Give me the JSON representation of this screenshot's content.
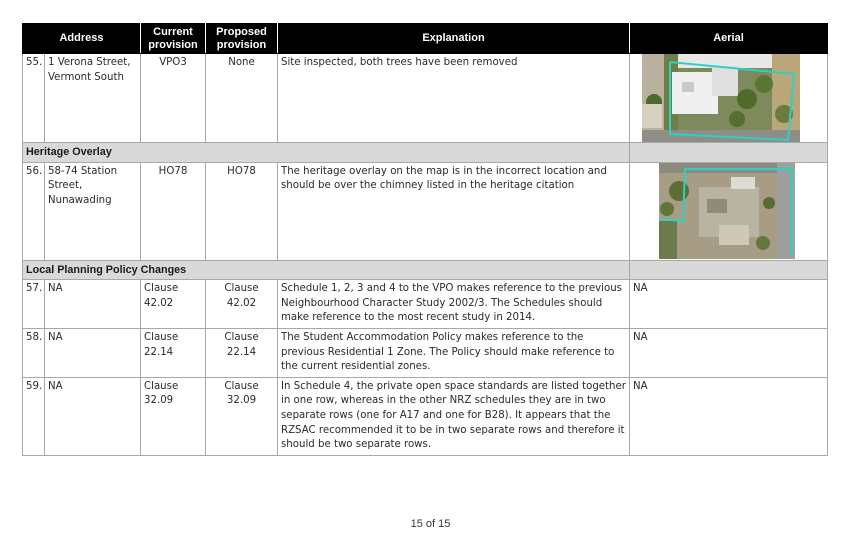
{
  "table": {
    "headers": {
      "address": "Address",
      "current": "Current provision",
      "proposed": "Proposed provision",
      "explanation": "Explanation",
      "aerial": "Aerial"
    },
    "row55": {
      "num": "55.",
      "address": "1 Verona Street, Vermont South",
      "current": "VPO3",
      "proposed": "None",
      "explanation": "Site inspected, both trees have been removed"
    },
    "section_heritage": "Heritage Overlay",
    "row56": {
      "num": "56.",
      "address": "58-74 Station Street, Nunawading",
      "current": "HO78",
      "proposed": "HO78",
      "explanation": "The heritage overlay on the map is in the incorrect location and should be over the chimney listed in the heritage citation"
    },
    "section_policy": "Local Planning Policy Changes",
    "row57": {
      "num": "57.",
      "address": "NA",
      "current": "Clause 42.02",
      "proposed": "Clause 42.02",
      "explanation": "Schedule 1, 2, 3 and 4 to the VPO makes reference to the previous Neighbourhood Character Study 2002/3. The Schedules should make reference to the most recent study in 2014.",
      "aerial": "NA"
    },
    "row58": {
      "num": "58.",
      "address": "NA",
      "current": "Clause 22.14",
      "proposed": "Clause 22.14",
      "explanation": "The Student Accommodation Policy makes reference to the previous Residential 1 Zone. The Policy should make reference to the current residential zones.",
      "aerial": "NA"
    },
    "row59": {
      "num": "59.",
      "address": "NA",
      "current": "Clause 32.09",
      "proposed": "Clause 32.09",
      "explanation": "In Schedule 4, the private open space standards are listed together in one row, whereas in the other NRZ schedules they are in two separate rows (one for A17 and one for B28). It appears that the RZSAC recommended it to be in two separate rows and therefore it should be two separate rows.",
      "aerial": "NA"
    }
  },
  "footer": {
    "page": "15 of 15"
  },
  "colors": {
    "header_bg": "#000000",
    "section_bg": "#d9d9d9",
    "boundary": "#2fd0c4"
  }
}
